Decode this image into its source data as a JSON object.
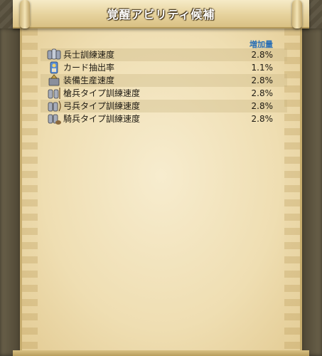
{
  "window": {
    "title": "覚醒アビリティ候補"
  },
  "table": {
    "value_header": "増加量",
    "rows": [
      {
        "name": "兵士訓練速度",
        "value": "2.8%",
        "icon": "knights-group-icon"
      },
      {
        "name": "カード抽出率",
        "value": "1.1%",
        "icon": "card-draw-icon"
      },
      {
        "name": "装備生産速度",
        "value": "2.8%",
        "icon": "equipment-production-icon"
      },
      {
        "name": "槍兵タイプ訓練速度",
        "value": "2.8%",
        "icon": "spearman-group-icon"
      },
      {
        "name": "弓兵タイプ訓練速度",
        "value": "2.8%",
        "icon": "archer-group-icon"
      },
      {
        "name": "騎兵タイプ訓練速度",
        "value": "2.8%",
        "icon": "cavalry-group-icon"
      }
    ]
  },
  "colors": {
    "header_accent": "#2a6fb5",
    "parchment": "#efdeb2",
    "frame": "#4a4232"
  }
}
